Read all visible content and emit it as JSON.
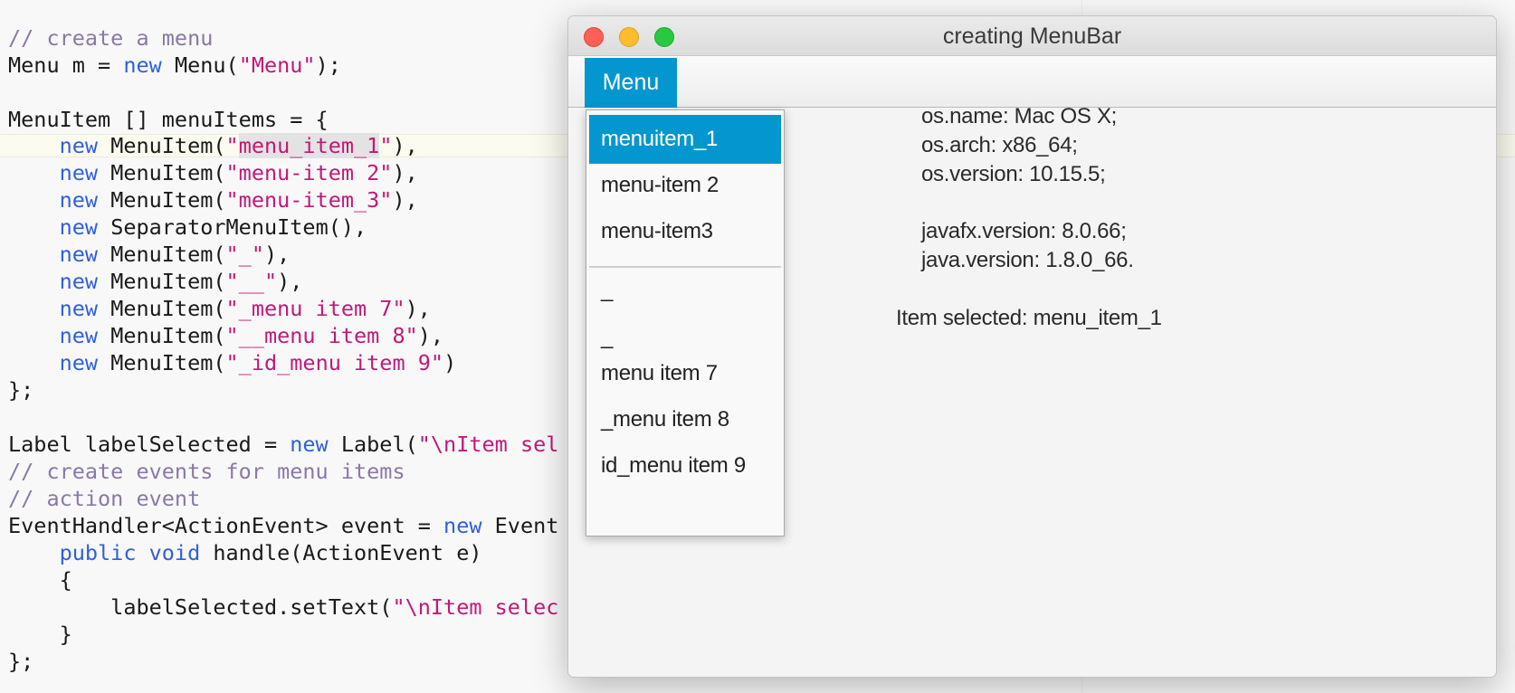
{
  "editor": {
    "lines": {
      "l1": [
        {
          "t": "// create a menu",
          "c": "cmt"
        }
      ],
      "l2": [
        {
          "t": "Menu m = ",
          "c": ""
        },
        {
          "t": "new",
          "c": "kw"
        },
        {
          "t": " Menu(",
          "c": ""
        },
        {
          "t": "\"Menu\"",
          "c": "str"
        },
        {
          "t": ");",
          "c": ""
        }
      ],
      "l3": [],
      "l4": [
        {
          "t": "MenuItem [] menuItems = {",
          "c": ""
        }
      ],
      "l5": [
        {
          "t": "    ",
          "c": ""
        },
        {
          "t": "new",
          "c": "kw"
        },
        {
          "t": " MenuItem(",
          "c": ""
        },
        {
          "t": "\"",
          "c": "str"
        },
        {
          "t": "menu_item_1",
          "c": "str hl"
        },
        {
          "t": "\"",
          "c": "str"
        },
        {
          "t": "),",
          "c": ""
        }
      ],
      "l6": [
        {
          "t": "    ",
          "c": ""
        },
        {
          "t": "new",
          "c": "kw"
        },
        {
          "t": " MenuItem(",
          "c": ""
        },
        {
          "t": "\"menu-item 2\"",
          "c": "str"
        },
        {
          "t": "),",
          "c": ""
        }
      ],
      "l7": [
        {
          "t": "    ",
          "c": ""
        },
        {
          "t": "new",
          "c": "kw"
        },
        {
          "t": " MenuItem(",
          "c": ""
        },
        {
          "t": "\"menu-item_3\"",
          "c": "str"
        },
        {
          "t": "),",
          "c": ""
        }
      ],
      "l8": [
        {
          "t": "    ",
          "c": ""
        },
        {
          "t": "new",
          "c": "kw"
        },
        {
          "t": " SeparatorMenuItem(),",
          "c": ""
        }
      ],
      "l9": [
        {
          "t": "    ",
          "c": ""
        },
        {
          "t": "new",
          "c": "kw"
        },
        {
          "t": " MenuItem(",
          "c": ""
        },
        {
          "t": "\"_\"",
          "c": "str"
        },
        {
          "t": "),",
          "c": ""
        }
      ],
      "l10": [
        {
          "t": "    ",
          "c": ""
        },
        {
          "t": "new",
          "c": "kw"
        },
        {
          "t": " MenuItem(",
          "c": ""
        },
        {
          "t": "\"__\"",
          "c": "str"
        },
        {
          "t": "),",
          "c": ""
        }
      ],
      "l11": [
        {
          "t": "    ",
          "c": ""
        },
        {
          "t": "new",
          "c": "kw"
        },
        {
          "t": " MenuItem(",
          "c": ""
        },
        {
          "t": "\"_menu item 7\"",
          "c": "str"
        },
        {
          "t": "),",
          "c": ""
        }
      ],
      "l12": [
        {
          "t": "    ",
          "c": ""
        },
        {
          "t": "new",
          "c": "kw"
        },
        {
          "t": " MenuItem(",
          "c": ""
        },
        {
          "t": "\"__menu item 8\"",
          "c": "str"
        },
        {
          "t": "),",
          "c": ""
        }
      ],
      "l13": [
        {
          "t": "    ",
          "c": ""
        },
        {
          "t": "new",
          "c": "kw"
        },
        {
          "t": " MenuItem(",
          "c": ""
        },
        {
          "t": "\"_id_menu item 9\"",
          "c": "str"
        },
        {
          "t": ")",
          "c": ""
        }
      ],
      "l14": [
        {
          "t": "};",
          "c": ""
        }
      ],
      "l15": [],
      "l16": [
        {
          "t": "Label labelSelected = ",
          "c": ""
        },
        {
          "t": "new",
          "c": "kw"
        },
        {
          "t": " Label(",
          "c": ""
        },
        {
          "t": "\"\\nItem sel",
          "c": "str"
        }
      ],
      "l17": [
        {
          "t": "// create events for menu items",
          "c": "cmt"
        }
      ],
      "l18": [
        {
          "t": "// action event",
          "c": "cmt"
        }
      ],
      "l19": [
        {
          "t": "EventHandler<ActionEvent> event = ",
          "c": ""
        },
        {
          "t": "new",
          "c": "kw"
        },
        {
          "t": " Event",
          "c": ""
        }
      ],
      "l20": [
        {
          "t": "    ",
          "c": ""
        },
        {
          "t": "public",
          "c": "kw"
        },
        {
          "t": " ",
          "c": ""
        },
        {
          "t": "void",
          "c": "kw"
        },
        {
          "t": " handle(ActionEvent e)",
          "c": ""
        }
      ],
      "l21": [
        {
          "t": "    {",
          "c": ""
        }
      ],
      "l22": [
        {
          "t": "        labelSelected.setText(",
          "c": ""
        },
        {
          "t": "\"\\nItem selec",
          "c": "str"
        }
      ],
      "l23": [
        {
          "t": "    }",
          "c": ""
        }
      ],
      "l24": [
        {
          "t": "};",
          "c": ""
        }
      ]
    }
  },
  "window": {
    "title": "creating MenuBar",
    "menu_label": "Menu",
    "menu_items": {
      "i1": "menuitem_1",
      "i2": "menu-item 2",
      "i3": "menu-item3",
      "i4": "_",
      "i5": "_",
      "i6": "menu item 7",
      "i7": "_menu item 8",
      "i8": "id_menu item 9"
    },
    "selected_item_index": 1,
    "info": {
      "os_name": "os.name: Mac OS X;",
      "os_arch": "os.arch: x86_64;",
      "os_version": "os.version: 10.15.5;",
      "javafx_version": "javafx.version: 8.0.66;",
      "java_version": "java.version: 1.8.0_66."
    },
    "item_selected": "Item selected: menu_item_1"
  },
  "colors": {
    "accent": "#0496cf",
    "keyword": "#2f5fdc",
    "string": "#c0197a",
    "comment": "#8a78a8"
  }
}
